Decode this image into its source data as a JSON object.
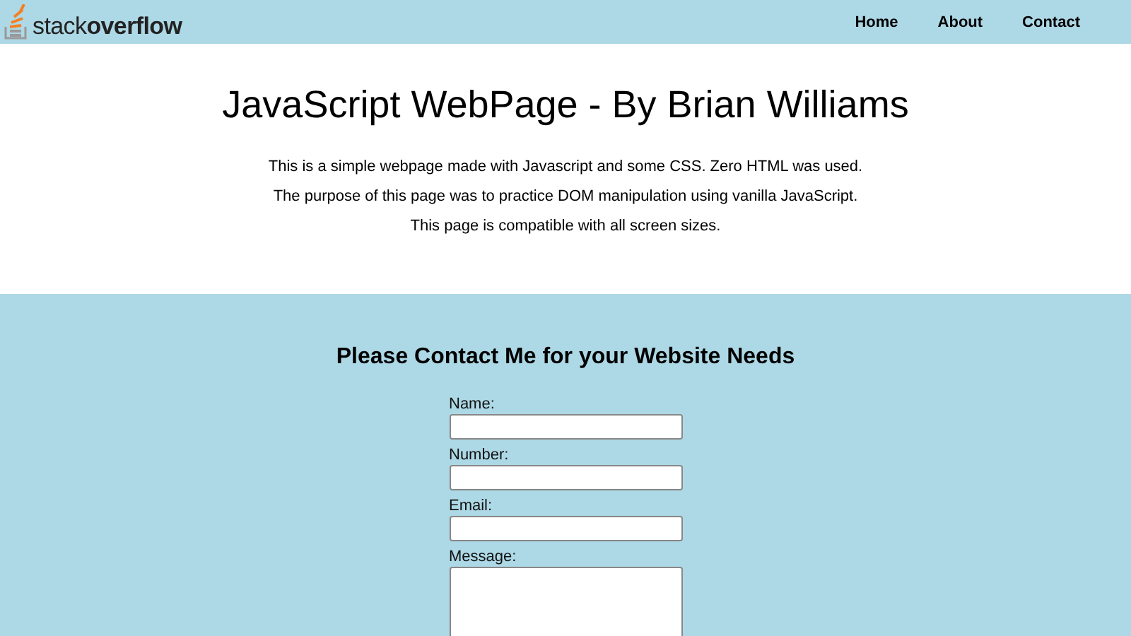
{
  "header": {
    "logo": "stack**overflow**",
    "nav": [
      {
        "label": "Home"
      },
      {
        "label": "About"
      },
      {
        "label": "Contact"
      }
    ]
  },
  "intro": {
    "title": "JavaScript WebPage - By Brian Williams",
    "paragraphs": [
      "This is a simple webpage made with Javascript and some CSS. Zero HTML was used.",
      "The purpose of this page was to practice DOM manipulation using vanilla JavaScript.",
      "This page is compatible with all screen sizes."
    ]
  },
  "contact": {
    "heading": "Please Contact Me for your Website Needs",
    "fields": [
      {
        "label": "Name:",
        "kind": "input"
      },
      {
        "label": "Number:",
        "kind": "input"
      },
      {
        "label": "Email:",
        "kind": "input"
      },
      {
        "label": "Message:",
        "kind": "textarea"
      }
    ]
  }
}
